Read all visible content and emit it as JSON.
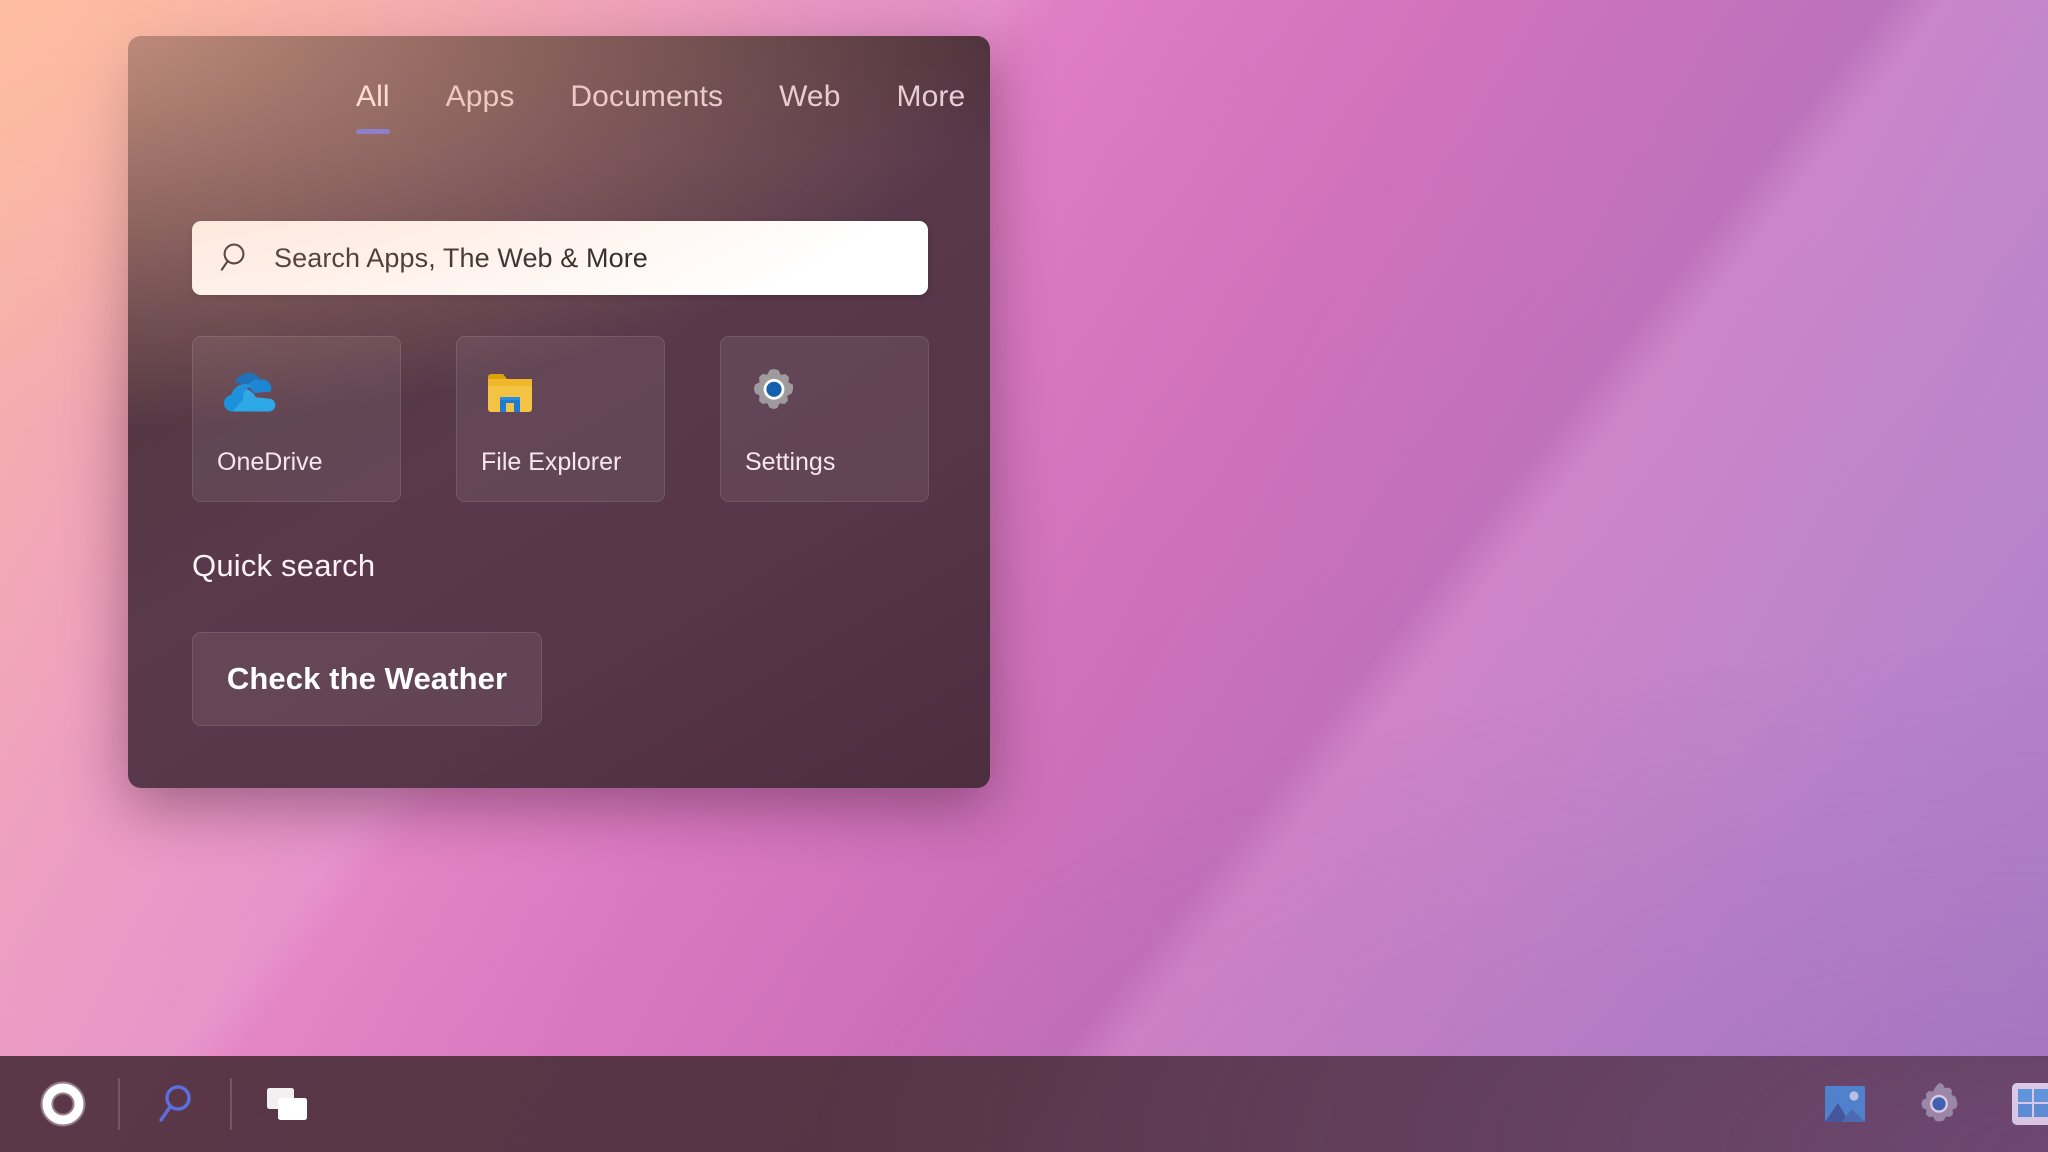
{
  "panel": {
    "tabs": [
      {
        "label": "All",
        "active": true,
        "name": "tab-all"
      },
      {
        "label": "Apps",
        "active": false,
        "name": "tab-apps"
      },
      {
        "label": "Documents",
        "active": false,
        "name": "tab-documents"
      },
      {
        "label": "Web",
        "active": false,
        "name": "tab-web"
      },
      {
        "label": "More",
        "active": false,
        "name": "tab-more"
      }
    ],
    "active_tab_indicator_color": "#4457e8",
    "search": {
      "placeholder": "Search Apps, The Web & More",
      "value": "",
      "icon": "search-icon"
    },
    "tiles": [
      {
        "label": "OneDrive",
        "icon": "onedrive-icon"
      },
      {
        "label": "File Explorer",
        "icon": "file-explorer-icon"
      },
      {
        "label": "Settings",
        "icon": "settings-gear-icon"
      }
    ],
    "quick_search": {
      "heading": "Quick search",
      "items": [
        {
          "label": "Check the Weather"
        }
      ]
    }
  },
  "taskbar": {
    "left_items": [
      {
        "label": "Start",
        "icon": "start-ring-icon"
      },
      {
        "label": "Search",
        "icon": "search-magnifier-icon"
      },
      {
        "label": "Task View",
        "icon": "task-view-icon"
      }
    ],
    "right_items": [
      {
        "label": "Photos",
        "icon": "photos-icon"
      },
      {
        "label": "Settings",
        "icon": "settings-gear-icon"
      },
      {
        "label": "Microsoft Store",
        "icon": "store-icon"
      }
    ]
  },
  "colors": {
    "panel_background": "#4f3440",
    "accent_blue": "#4457e8",
    "search_field_background": "#ffffff",
    "taskbar_background": "#4a2e38",
    "text_primary": "#fbf2f5"
  }
}
